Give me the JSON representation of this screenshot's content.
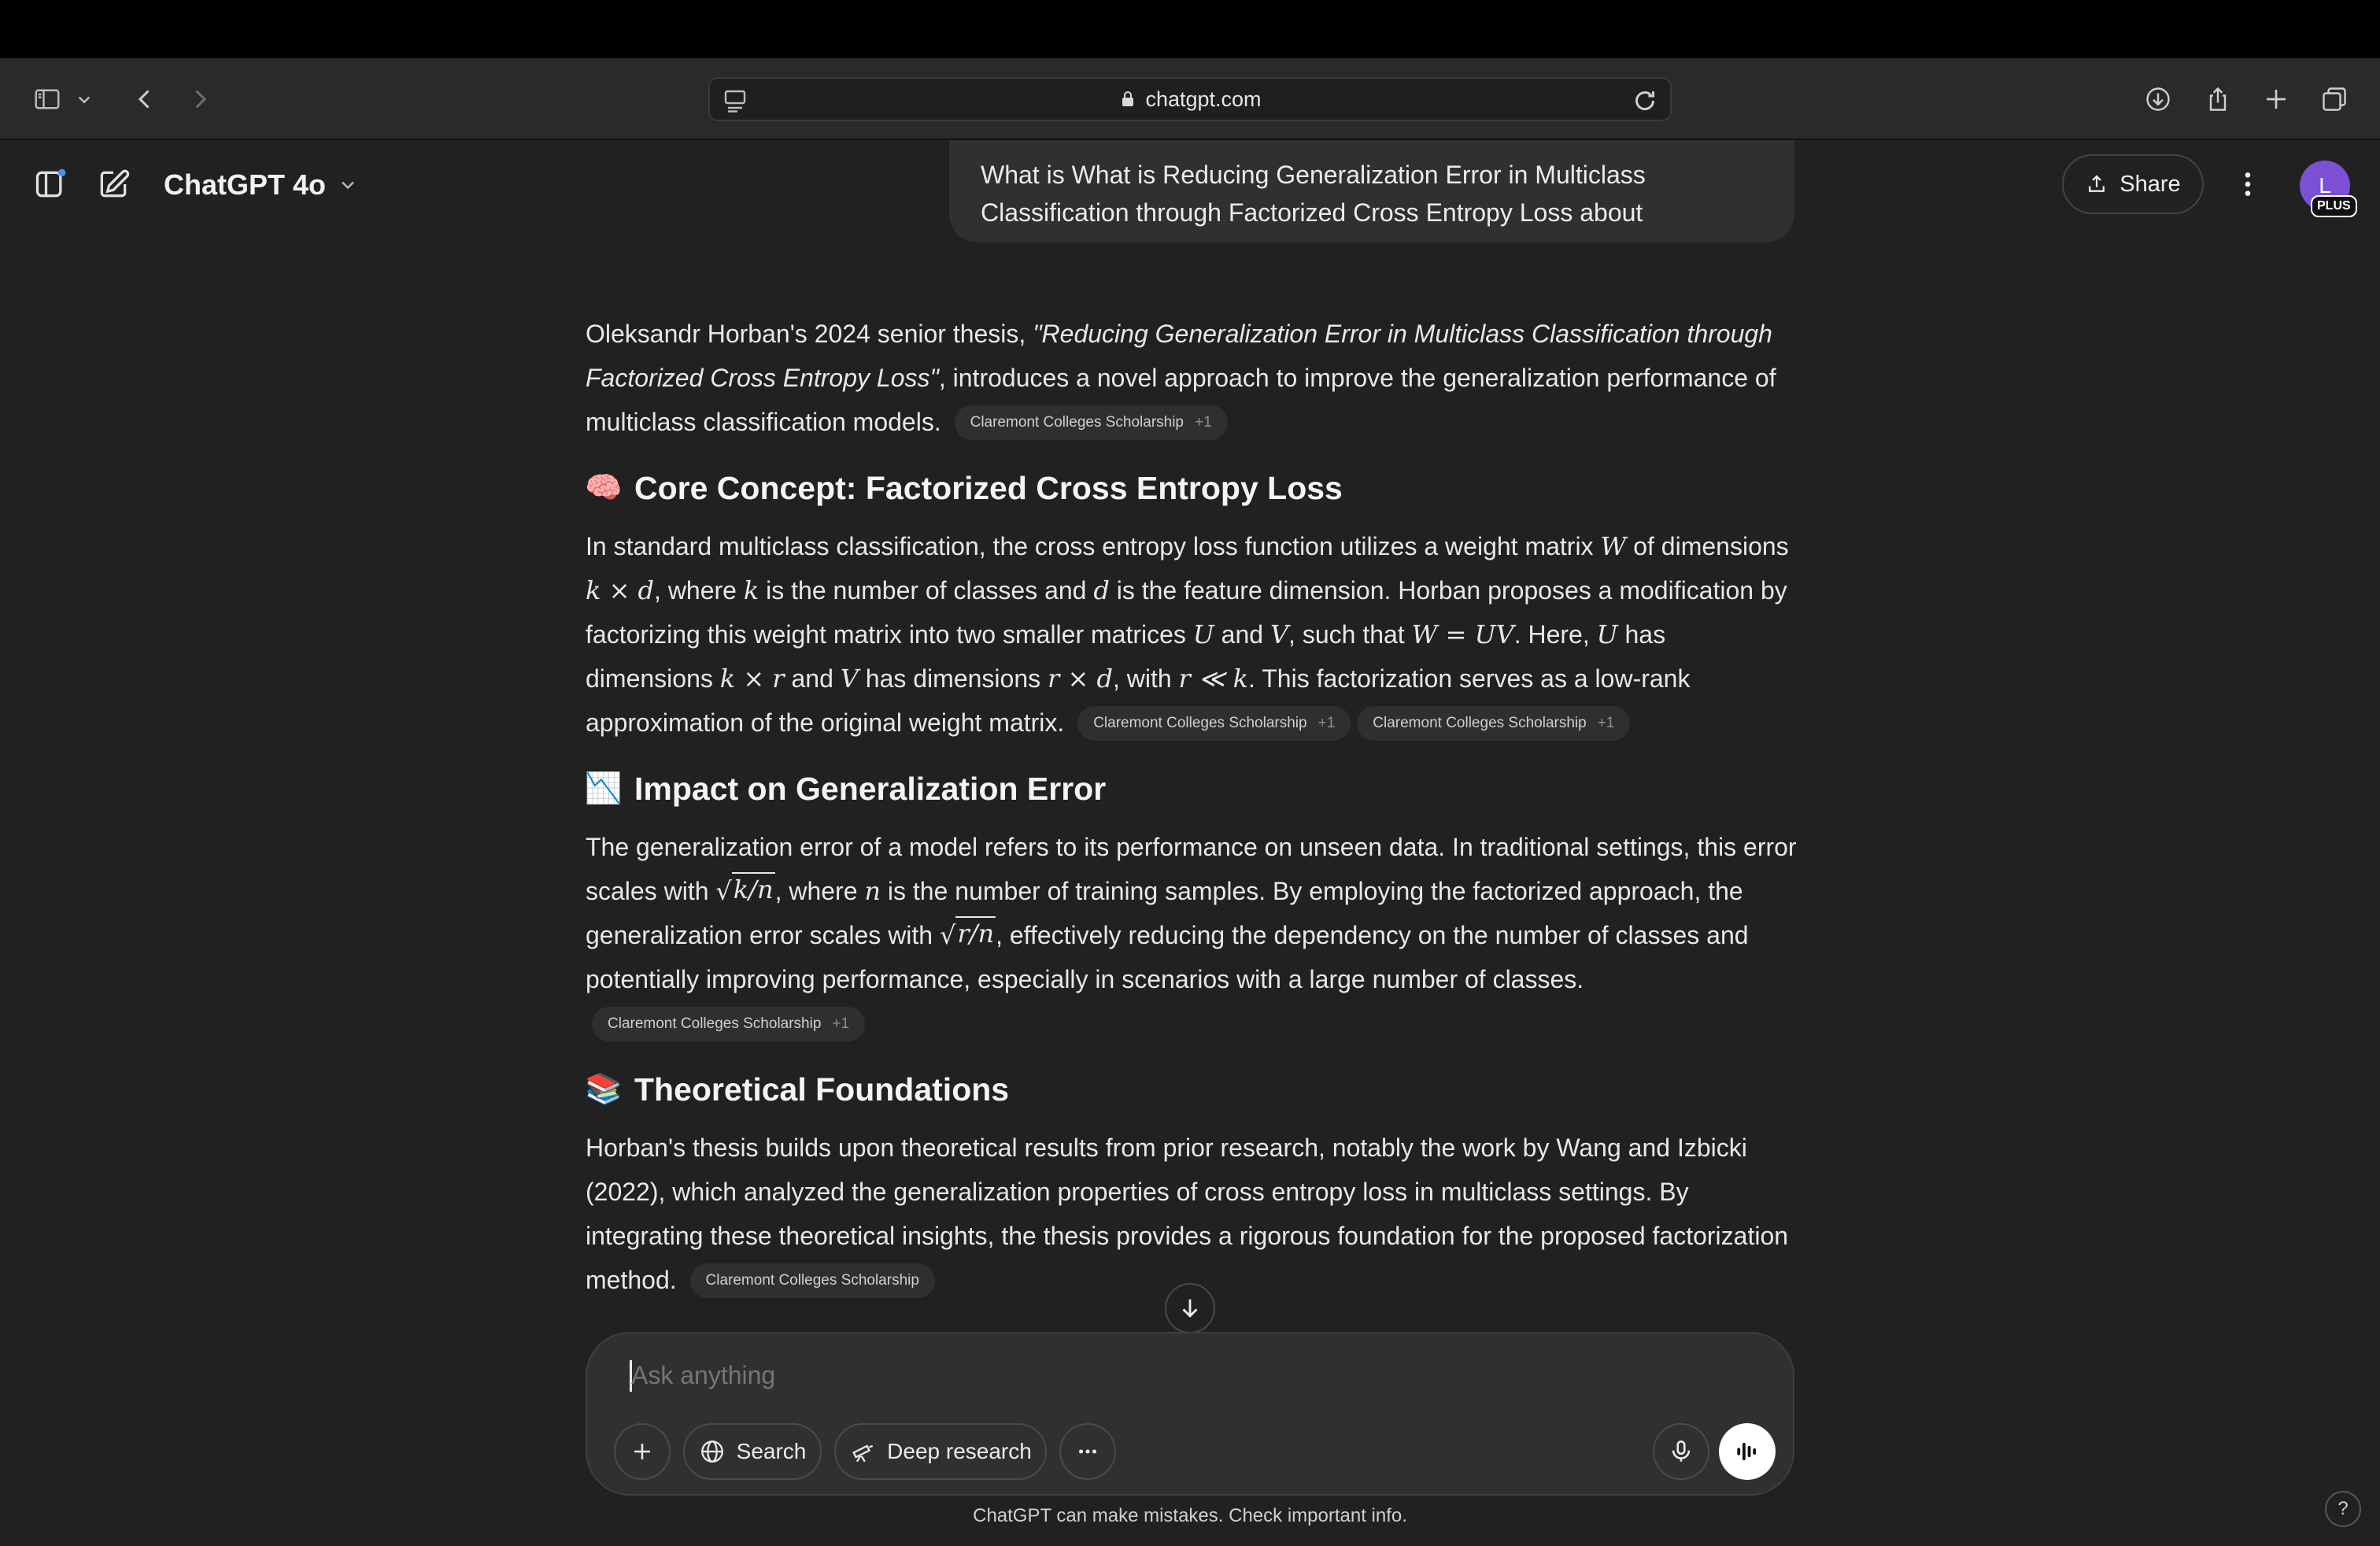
{
  "browser": {
    "url": "chatgpt.com"
  },
  "header": {
    "model_name": "ChatGPT 4o",
    "share_label": "Share",
    "avatar_initial": "L",
    "plan_badge": "PLUS"
  },
  "user_message": "What is What is Reducing Generalization Error in Multiclass Classification through Factorized Cross Entropy Loss about",
  "answer": {
    "intro": {
      "pre": "Oleksandr Horban's 2024 senior thesis, ",
      "title_italic": "\"Reducing Generalization Error in Multiclass Classification through Factorized Cross Entropy Loss\"",
      "post": ", introduces a novel approach to improve the generalization performance of multiclass classification models."
    },
    "sections": [
      {
        "emoji": "🧠",
        "heading": "Core Concept: Factorized Cross Entropy Loss"
      },
      {
        "emoji": "📉",
        "heading": "Impact on Generalization Error"
      },
      {
        "emoji": "📚",
        "heading": "Theoretical Foundations"
      }
    ],
    "core": {
      "t1": "In standard multiclass classification, the cross entropy loss function utilizes a weight matrix ",
      "t2": " of dimensions ",
      "t3": ", where ",
      "t4": " is the number of classes and ",
      "t5": " is the feature dimension. Horban proposes a modification by factorizing this weight matrix into two smaller matrices ",
      "t6": " and ",
      "t7": ", such that ",
      "t8": ". Here, ",
      "t9": " has dimensions ",
      "t10": " and ",
      "t11": " has dimensions ",
      "t12": ", with ",
      "t13": ". This factorization serves as a low-rank approximation of the original weight matrix."
    },
    "impact": {
      "t1": "The generalization error of a model refers to its performance on unseen data. In traditional settings, this error scales with ",
      "t2": ", where ",
      "t3": " is the number of training samples. By employing the factorized approach, the generalization error scales with ",
      "t4": ", effectively reducing the dependency on the number of classes and potentially improving performance, especially in scenarios with a large number of classes."
    },
    "foundations": {
      "text": "Horban's thesis builds upon theoretical results from prior research, notably the work by Wang and Izbicki (2022), which analyzed the generalization properties of cross entropy loss in multiclass settings. By integrating these theoretical insights, the thesis provides a rigorous foundation for the proposed factorization method."
    },
    "math": {
      "W": "W",
      "kxd": "k × d",
      "k": "k",
      "d": "d",
      "U": "U",
      "V": "V",
      "WUV": "W = UV",
      "kxr": "k × r",
      "rxd": "r × d",
      "rllk": "r ≪ k",
      "n": "n",
      "kn": "k/n",
      "rn": "r/n"
    },
    "citations": {
      "source": "Claremont Colleges Scholarship",
      "count": "+1"
    }
  },
  "composer": {
    "placeholder": "Ask anything",
    "search_label": "Search",
    "deep_research_label": "Deep research"
  },
  "footer": {
    "disclaimer": "ChatGPT can make mistakes. Check important info.",
    "help": "?"
  }
}
